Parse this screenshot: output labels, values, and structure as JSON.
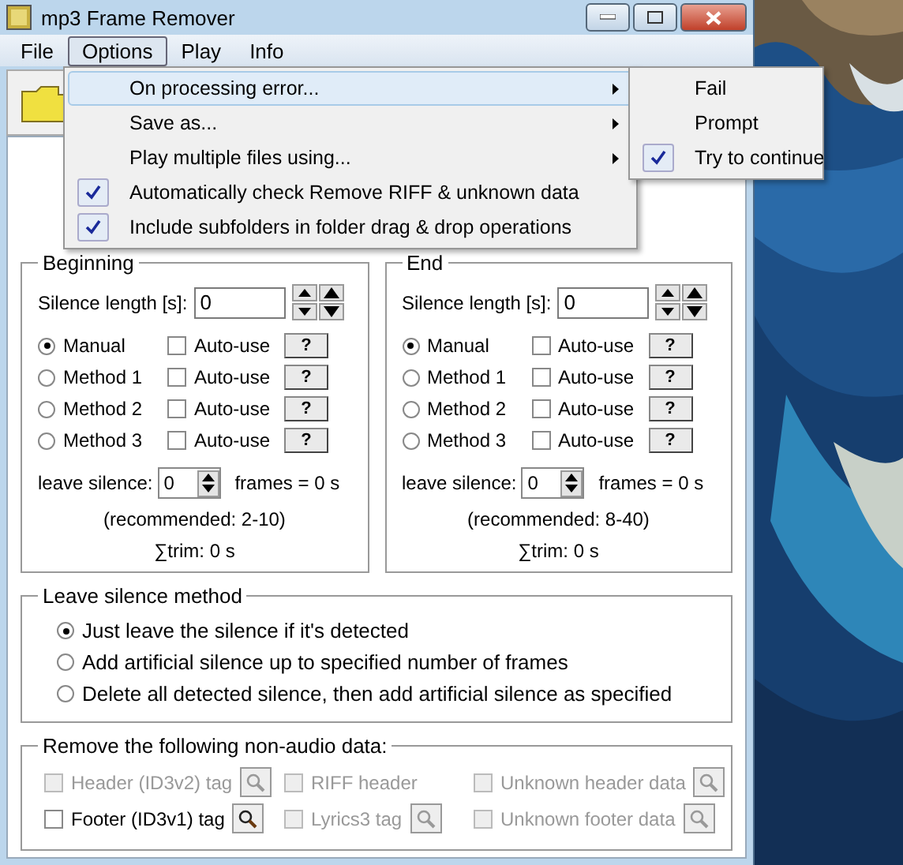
{
  "window": {
    "title": "mp3 Frame Remover"
  },
  "menu_bar": [
    {
      "label": "File",
      "selected": false
    },
    {
      "label": "Options",
      "selected": true
    },
    {
      "label": "Play",
      "selected": false
    },
    {
      "label": "Info",
      "selected": false
    }
  ],
  "options_menu": [
    {
      "label": "On processing error...",
      "submenu": true,
      "checked": false,
      "selected": true
    },
    {
      "label": "Save as...",
      "submenu": true,
      "checked": false,
      "selected": false
    },
    {
      "label": "Play multiple files using...",
      "submenu": true,
      "checked": false,
      "selected": false
    },
    {
      "label": "Automatically check Remove RIFF & unknown data",
      "submenu": false,
      "checked": true,
      "selected": false
    },
    {
      "label": "Include subfolders in folder drag & drop operations",
      "submenu": false,
      "checked": true,
      "selected": false
    }
  ],
  "error_submenu": [
    {
      "label": "Fail",
      "checked": false
    },
    {
      "label": "Prompt",
      "checked": false
    },
    {
      "label": "Try to continue",
      "checked": true
    }
  ],
  "sections": [
    {
      "title": "Beginning",
      "silence_label": "Silence length [s]:",
      "silence_length": "0",
      "methods": [
        {
          "label": "Manual",
          "selected": true,
          "auto_use": false,
          "auto_label": "Auto-use",
          "help": "?"
        },
        {
          "label": "Method 1",
          "selected": false,
          "auto_use": false,
          "auto_label": "Auto-use",
          "help": "?"
        },
        {
          "label": "Method 2",
          "selected": false,
          "auto_use": false,
          "auto_label": "Auto-use",
          "help": "?"
        },
        {
          "label": "Method 3",
          "selected": false,
          "auto_use": false,
          "auto_label": "Auto-use",
          "help": "?"
        }
      ],
      "leave_label": "leave silence:",
      "leave_value": "0",
      "frames_text": "frames = 0 s",
      "recommended": "(recommended: 2-10)",
      "trim": "∑trim:  0 s"
    },
    {
      "title": "End",
      "silence_label": "Silence length [s]:",
      "silence_length": "0",
      "methods": [
        {
          "label": "Manual",
          "selected": true,
          "auto_use": false,
          "auto_label": "Auto-use",
          "help": "?"
        },
        {
          "label": "Method 1",
          "selected": false,
          "auto_use": false,
          "auto_label": "Auto-use",
          "help": "?"
        },
        {
          "label": "Method 2",
          "selected": false,
          "auto_use": false,
          "auto_label": "Auto-use",
          "help": "?"
        },
        {
          "label": "Method 3",
          "selected": false,
          "auto_use": false,
          "auto_label": "Auto-use",
          "help": "?"
        }
      ],
      "leave_label": "leave silence:",
      "leave_value": "0",
      "frames_text": "frames = 0 s",
      "recommended": "(recommended: 8-40)",
      "trim": "∑trim:  0 s"
    }
  ],
  "leave_silence_method": {
    "title": "Leave silence method",
    "options": [
      {
        "label": "Just leave the silence if it's detected",
        "selected": true
      },
      {
        "label": "Add artificial silence up to specified number of frames",
        "selected": false
      },
      {
        "label": "Delete all detected silence, then add artificial silence as specified",
        "selected": false
      }
    ]
  },
  "remove_data": {
    "title": "Remove the following non-audio data:",
    "items": [
      {
        "label": "Header (ID3v2) tag",
        "checked": false,
        "disabled": true,
        "preview": true
      },
      {
        "label": "RIFF header",
        "checked": false,
        "disabled": true,
        "preview": false
      },
      {
        "label": "Unknown header data",
        "checked": false,
        "disabled": true,
        "preview": true
      },
      {
        "label": "Footer (ID3v1) tag",
        "checked": false,
        "disabled": false,
        "preview": true
      },
      {
        "label": "Lyrics3 tag",
        "checked": false,
        "disabled": true,
        "preview": true
      },
      {
        "label": "Unknown footer data",
        "checked": false,
        "disabled": true,
        "preview": true
      }
    ]
  }
}
